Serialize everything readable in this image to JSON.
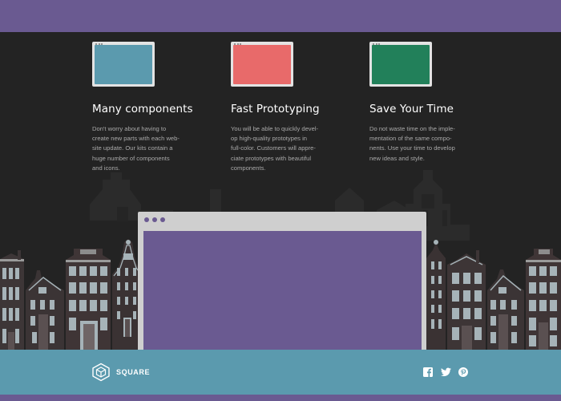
{
  "colors": {
    "brand_purple": "#6a5a91",
    "dark_bg": "#232323",
    "footer_teal": "#5b9aae",
    "card_blue": "#5b9aae",
    "card_red": "#e86a6a",
    "card_green": "#22805a"
  },
  "features": [
    {
      "title": "Many components",
      "icon": "browser-window-icon",
      "color": "#5b9aae",
      "text_lines": [
        "Don't worry about having to",
        "create new parts with each web-",
        "site update. Our kits contain a",
        "huge number of components",
        "and icons."
      ]
    },
    {
      "title": "Fast Prototyping",
      "icon": "browser-window-icon",
      "color": "#e86a6a",
      "text_lines": [
        "You will be able to quickly devel-",
        "op high-quality prototypes in",
        "full-color. Customers will appre-",
        "ciate prototypes with beautiful",
        "components."
      ]
    },
    {
      "title": "Save Your Time",
      "icon": "browser-window-icon",
      "color": "#22805a",
      "text_lines": [
        "Do not waste time on the imple-",
        "mentation of the same compo-",
        "nents. Use your time to develop",
        "new ideas and style."
      ]
    }
  ],
  "footer": {
    "logo_text": "SQUARE",
    "logo_icon": "cube-icon",
    "social": [
      "facebook-icon",
      "twitter-icon",
      "pinterest-icon"
    ]
  }
}
